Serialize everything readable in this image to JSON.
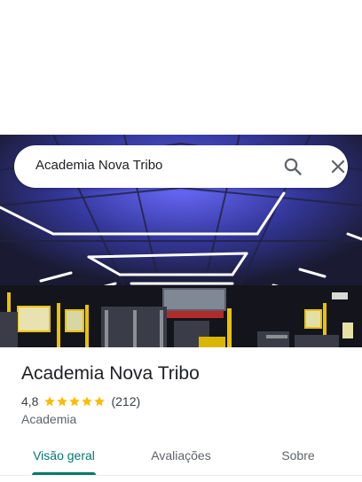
{
  "search": {
    "query": "Academia Nova Tribo"
  },
  "place": {
    "name": "Academia Nova Tribo",
    "rating": "4,8",
    "stars": 4.8,
    "review_count": "(212)",
    "category": "Academia"
  },
  "tabs": [
    {
      "label": "Visão geral",
      "active": true
    },
    {
      "label": "Avaliações",
      "active": false
    },
    {
      "label": "Sobre",
      "active": false
    }
  ],
  "colors": {
    "accent": "#00796b",
    "star": "#fbbc04",
    "led": "#ffffff",
    "ceiling_glow": "#5b5cff"
  },
  "icons": [
    "search-icon",
    "close-icon",
    "star-icon"
  ]
}
